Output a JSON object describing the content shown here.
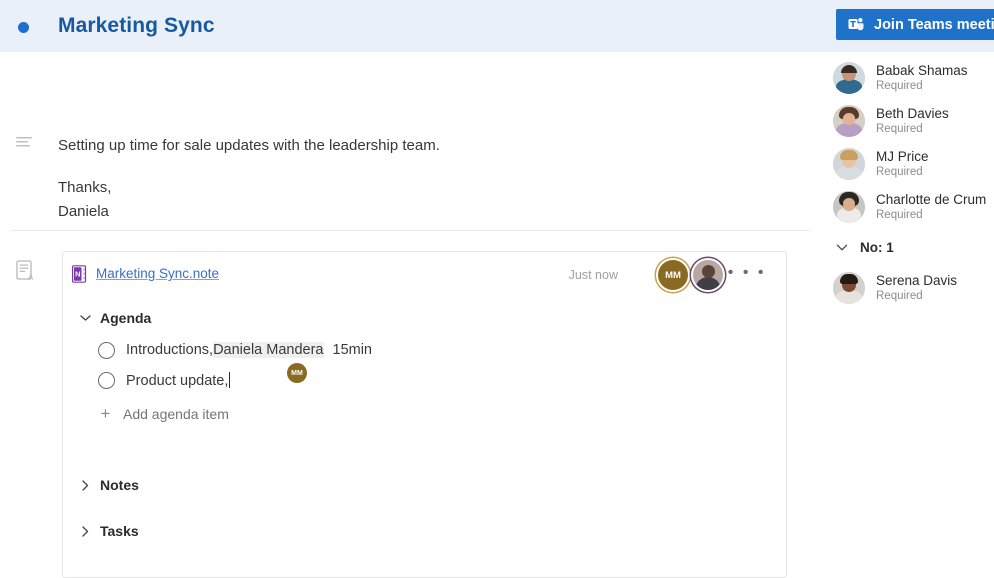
{
  "header": {
    "title": "Marketing Sync",
    "status_dot_color": "#1f6fd0",
    "band_color": "#e9f0fa",
    "join_button": {
      "label": "Join Teams meetin",
      "icon": "teams-icon",
      "color": "#1f72c9"
    }
  },
  "description": {
    "icon": "description-lines-icon",
    "line1": "Setting up time for sale updates with the leadership team.",
    "line2": "Thanks,",
    "line3": "Daniela"
  },
  "note_card": {
    "rail_icon": "note-document-icon",
    "file_icon": "onenote-icon",
    "file_name": "Marketing Sync.note",
    "timestamp": "Just now",
    "avatars": [
      {
        "name": "collaborator-mm-avatar",
        "initials": "MM",
        "ring_color": "#caa34a"
      },
      {
        "name": "collaborator-photo-avatar",
        "initials": "",
        "ring_color": "#6d4a6b"
      }
    ],
    "more_menu": "• • •",
    "sections": [
      {
        "key": "agenda",
        "label": "Agenda",
        "expanded": true,
        "chevron": "⌄"
      },
      {
        "key": "notes",
        "label": "Notes",
        "expanded": false,
        "chevron": "›"
      },
      {
        "key": "tasks",
        "label": "Tasks",
        "expanded": false,
        "chevron": "›"
      }
    ],
    "agenda_items": [
      {
        "text": "Introductions,",
        "highlight": "Daniela Mandera",
        "duration": "15min",
        "cursor": false
      },
      {
        "text": "Product update,",
        "highlight": "",
        "duration": "",
        "cursor": true,
        "cursor_initials": "MM"
      }
    ],
    "add_item_label": "Add agenda item",
    "add_item_icon": "plus-icon"
  },
  "attendees": {
    "people": [
      {
        "name": "Babak Shamas",
        "role": "Required",
        "skin": "#c79478",
        "hair": "#3a2a22",
        "shirt": "#2f6b8f",
        "bg": "#cfd9e0"
      },
      {
        "name": "Beth Davies",
        "role": "Required",
        "skin": "#e2b295",
        "hair": "#5a3a28",
        "shirt": "#b79ec4",
        "bg": "#d6cfc6"
      },
      {
        "name": "MJ Price",
        "role": "Required",
        "skin": "#e8c2a2",
        "hair": "#c9a15e",
        "shirt": "#d8dde2",
        "bg": "#d2d6da"
      },
      {
        "name": "Charlotte de Crum",
        "role": "Required",
        "skin": "#d9ac8c",
        "hair": "#2a2724",
        "shirt": "#eceaea",
        "bg": "#c9c6c2"
      }
    ],
    "group": {
      "label": "No: 1",
      "chevron": "⌄",
      "expanded": true
    },
    "group_people": [
      {
        "name": "Serena Davis",
        "role": "Required",
        "skin": "#7a4a32",
        "hair": "#241a14",
        "shirt": "#e7e2de",
        "bg": "#d5d0cb"
      }
    ]
  }
}
